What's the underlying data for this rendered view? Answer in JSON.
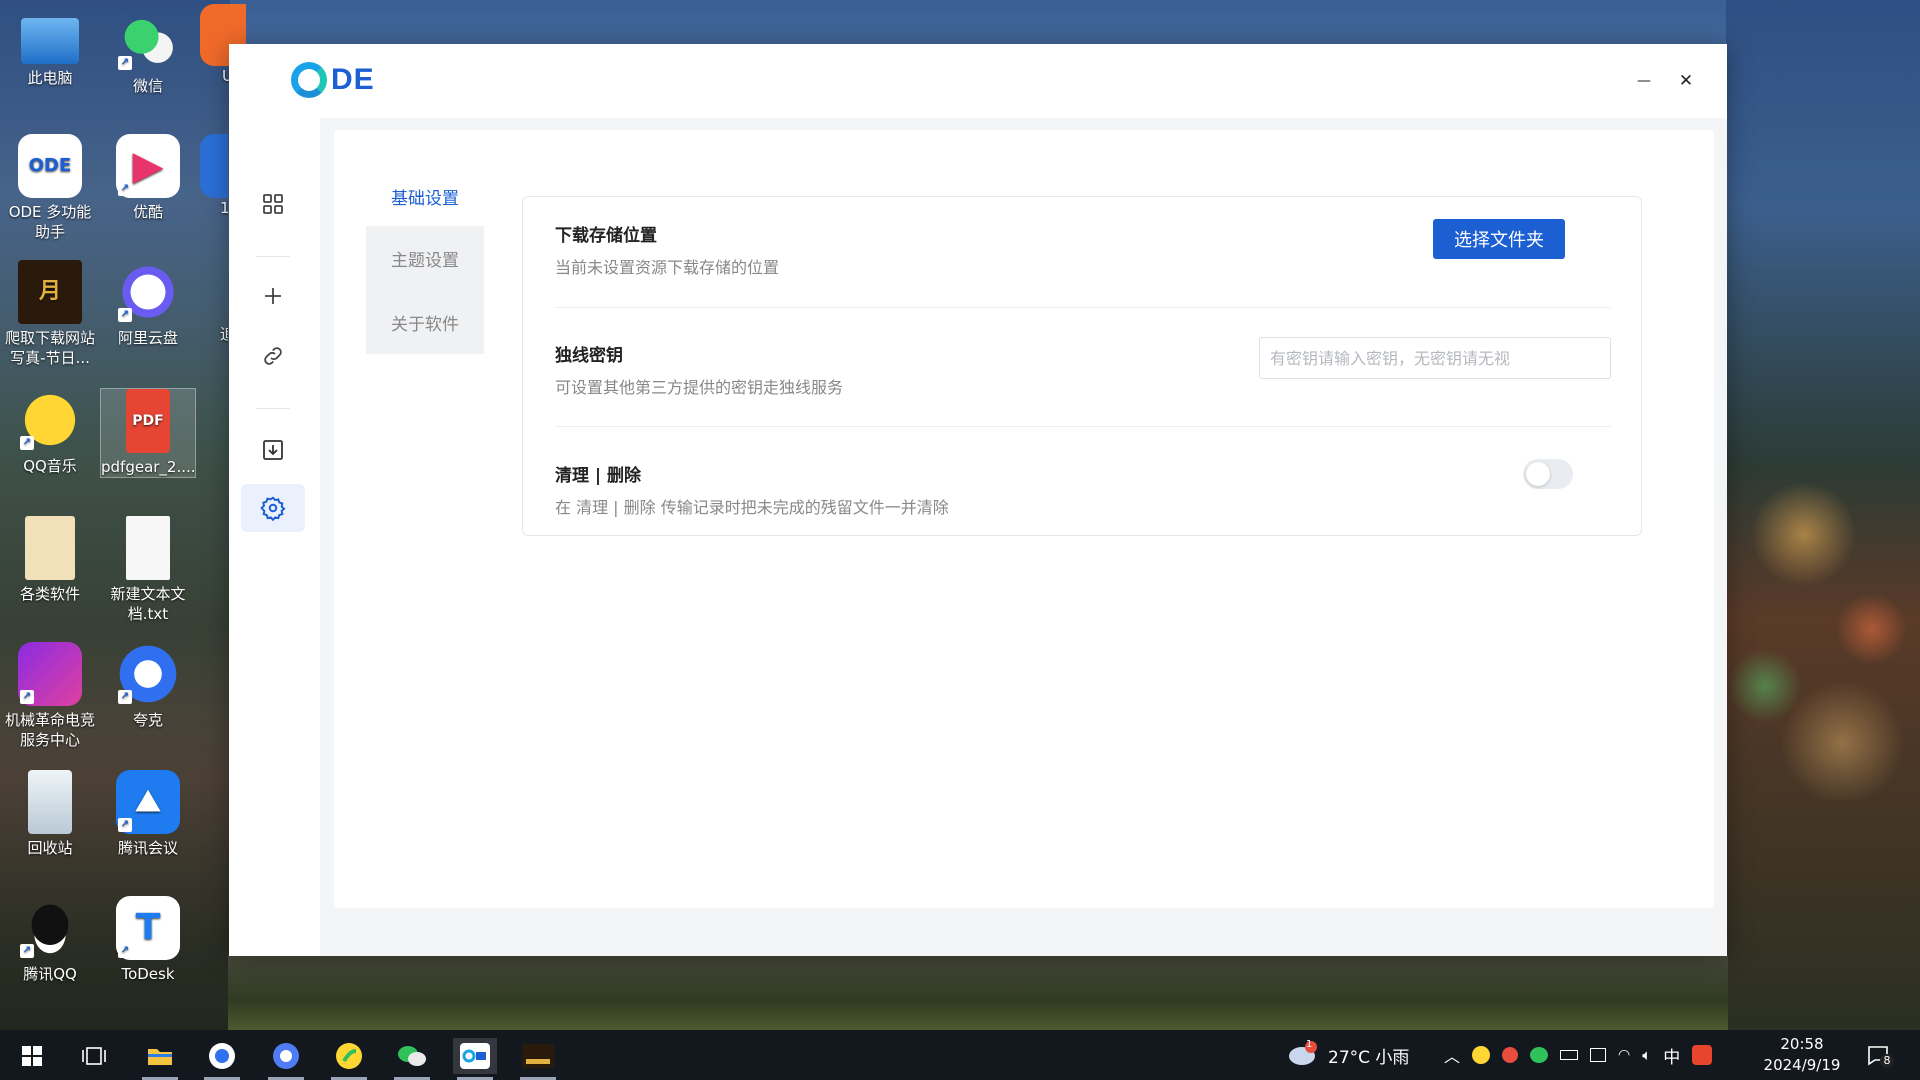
{
  "desktop": {
    "icons": [
      {
        "label": "此电脑"
      },
      {
        "label": "微信"
      },
      {
        "label": "U"
      },
      {
        "label": "ODE 多功能助手"
      },
      {
        "label": "优酷"
      },
      {
        "label": "1"
      },
      {
        "label": "爬取下载网站写真-节日..."
      },
      {
        "label": "阿里云盘"
      },
      {
        "label": "追"
      },
      {
        "label": "QQ音乐"
      },
      {
        "label": "pdfgear_2...."
      },
      {
        "label": "各类软件"
      },
      {
        "label": "新建文本文档.txt"
      },
      {
        "label": "机械革命电竞服务中心"
      },
      {
        "label": "夸克"
      },
      {
        "label": "回收站"
      },
      {
        "label": "腾讯会议"
      },
      {
        "label": "腾讯QQ"
      },
      {
        "label": "ToDesk"
      }
    ]
  },
  "window": {
    "logo_text": "DE",
    "minimize_glyph": "—",
    "close_glyph": "✕",
    "sidebar": [
      "grid-icon",
      "plus-icon",
      "link-icon",
      "download-icon",
      "gear-icon"
    ],
    "tabs": [
      {
        "label": "基础设置",
        "active": true
      },
      {
        "label": "主题设置",
        "active": false
      },
      {
        "label": "关于软件",
        "active": false
      }
    ],
    "settings": {
      "download": {
        "title": "下载存储位置",
        "desc": "当前未设置资源下载存储的位置",
        "button": "选择文件夹"
      },
      "key": {
        "title": "独线密钥",
        "desc": "可设置其他第三方提供的密钥走独线服务",
        "placeholder": "有密钥请输入密钥，无密钥请无视",
        "value": ""
      },
      "cleanup": {
        "title": "清理 | 删除",
        "desc": "在 清理 | 删除 传输记录时把未完成的残留文件一并清除",
        "enabled": false
      }
    },
    "accent_color": "#1b5fd3"
  },
  "taskbar": {
    "weather": "27°C 小雨",
    "weather_badge": "1",
    "ime": "中",
    "time": "20:58",
    "date": "2024/9/19",
    "notification_count": "8"
  }
}
